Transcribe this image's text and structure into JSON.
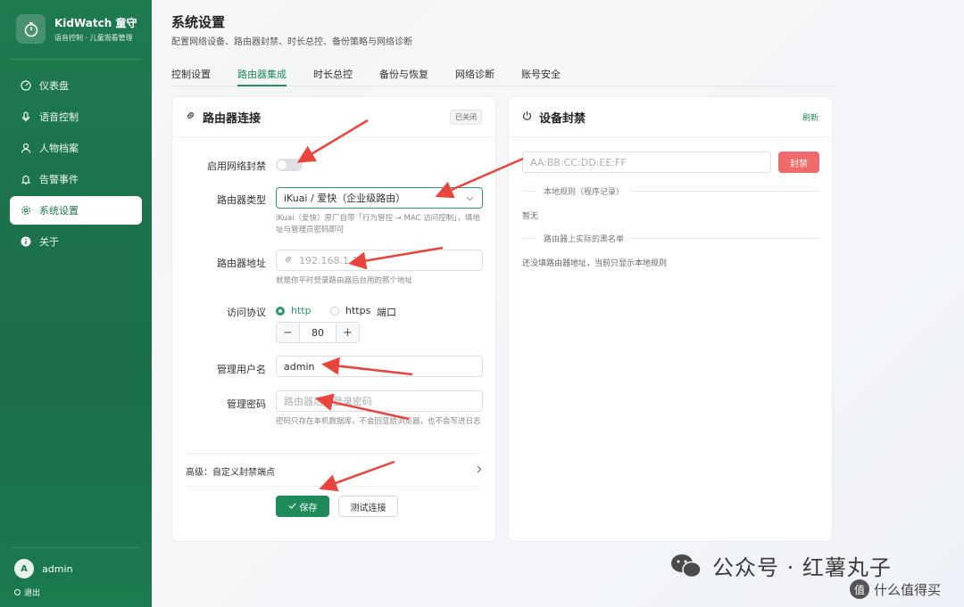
{
  "brand": {
    "title": "KidWatch 童守",
    "subtitle": "语音控制 · 儿童观看管理"
  },
  "nav": [
    {
      "label": "仪表盘",
      "icon": "dashboard-icon"
    },
    {
      "label": "语音控制",
      "icon": "mic-icon"
    },
    {
      "label": "人物档案",
      "icon": "person-icon"
    },
    {
      "label": "告警事件",
      "icon": "bell-icon"
    },
    {
      "label": "系统设置",
      "icon": "gear-icon",
      "active": true
    },
    {
      "label": "关于",
      "icon": "info-icon"
    }
  ],
  "user": {
    "initial": "A",
    "name": "admin",
    "logout": "退出"
  },
  "page": {
    "title": "系统设置",
    "subtitle": "配置网络设备、路由器封禁、时长总控、备份策略与网络诊断"
  },
  "tabs": [
    "控制设置",
    "路由器集成",
    "时长总控",
    "备份与恢复",
    "网络诊断",
    "账号安全"
  ],
  "router": {
    "title": "路由器连接",
    "status_badge": "已关闭",
    "enable_label": "启用网络封禁",
    "enabled": false,
    "type_label": "路由器类型",
    "type_value": "iKuai / 爱快（企业级路由）",
    "type_hint": "iKuai（爱快）原厂自带「行为管控 → MAC 访问控制」，填地址与管理员密码即可",
    "addr_label": "路由器地址",
    "addr_placeholder": "192.168.1.1",
    "addr_hint": "就是你平时登录路由器后台用的那个地址",
    "protocol_label": "访问协议",
    "protocol_options": [
      "http",
      "https"
    ],
    "protocol_selected": "http",
    "port_label": "端口",
    "port_value": "80",
    "user_label": "管理用户名",
    "user_value": "admin",
    "pwd_label": "管理密码",
    "pwd_placeholder": "路由器后台登录密码",
    "pwd_hint": "密码只存在本机数据库，不会回显给浏览器，也不会写进日志",
    "advanced_label": "高级：自定义封禁端点",
    "save_label": "保存",
    "test_label": "测试连接"
  },
  "ban": {
    "title": "设备封禁",
    "refresh": "刷新",
    "mac_placeholder": "AA:BB:CC:DD:EE:FF",
    "ban_button": "封禁",
    "local_rules_title": "本地规则（程序记录）",
    "local_rules_empty": "暂无",
    "router_list_title": "路由器上实际的黑名单",
    "router_list_note": "还没填路由器地址，当前只显示本地规则"
  },
  "watermark": {
    "text": "公众号 · 红薯丸子",
    "corner": "什么值得买"
  },
  "colors": {
    "sidebar": "#1f7a50",
    "accent": "#1f8a5a",
    "danger": "#ef6a6a",
    "arrow": "#e8453c"
  }
}
